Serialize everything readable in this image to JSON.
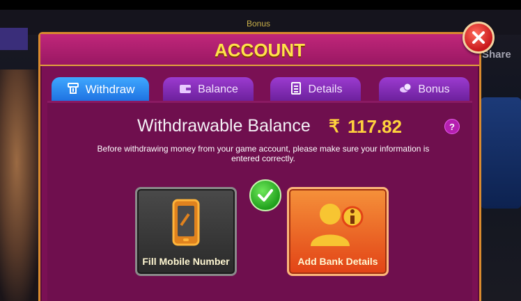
{
  "background": {
    "bonus_label": "Bonus",
    "share_label": "Share"
  },
  "dialog": {
    "title": "ACCOUNT",
    "tabs": [
      {
        "label": "Withdraw",
        "icon": "withdraw-icon",
        "active": true
      },
      {
        "label": "Balance",
        "icon": "wallet-icon",
        "active": false
      },
      {
        "label": "Details",
        "icon": "document-icon",
        "active": false
      },
      {
        "label": "Bonus",
        "icon": "coins-icon",
        "active": false
      }
    ],
    "withdraw": {
      "balance_label": "Withdrawable Balance",
      "currency_symbol": "₹",
      "balance_value": "117.82",
      "help_symbol": "?",
      "notice": "Before withdrawing money from your  game account, please make sure your information is entered correctly.",
      "options": [
        {
          "label": "Fill Mobile Number",
          "icon": "mobile-phone-icon",
          "completed": true
        },
        {
          "label": "Add Bank Details",
          "icon": "user-info-icon",
          "completed": false
        }
      ]
    }
  },
  "colors": {
    "dialog_bg": "#7a1054",
    "title": "#ffe24a",
    "balance": "#ffd23d",
    "active_tab": "#1d6fe0",
    "inactive_tab": "#6a1f9a"
  }
}
